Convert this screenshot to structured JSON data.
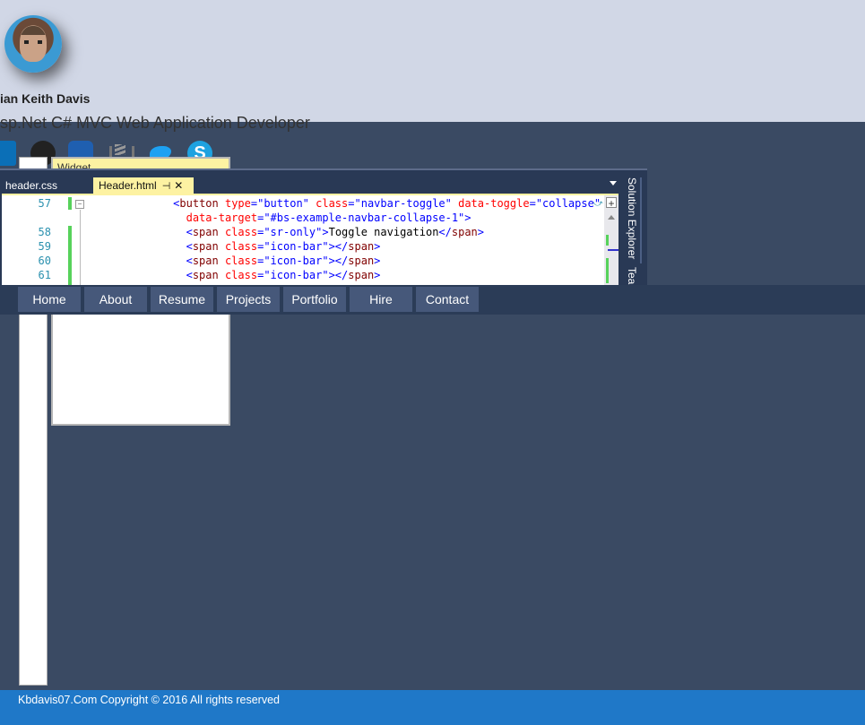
{
  "profile": {
    "name": "ian Keith Davis",
    "subtitle": "sp.Net C# MVC Web Application Developer"
  },
  "social_icons": [
    "linkedin-icon",
    "github-icon",
    "stackshare-icon",
    "stackoverflow-icon",
    "twitter-icon",
    "skype-icon"
  ],
  "background_panel": {
    "header_text": "Widget"
  },
  "editor": {
    "tabs": [
      {
        "label": "header.css",
        "active": false
      },
      {
        "label": "Header.html",
        "active": true,
        "pin_icon": "pin-icon",
        "close_label": "✕"
      }
    ],
    "line_numbers": [
      "57",
      "",
      "58",
      "59",
      "60",
      "61"
    ],
    "lines": [
      {
        "indent": "              ",
        "parts": [
          [
            "br",
            "<"
          ],
          [
            "tg",
            "button"
          ],
          [
            "",
            ""
          ],
          [
            "at",
            " type"
          ],
          [
            "br",
            "="
          ],
          [
            "st",
            "\"button\""
          ],
          [
            "at",
            " class"
          ],
          [
            "br",
            "="
          ],
          [
            "st",
            "\"navbar-toggle\""
          ],
          [
            "at",
            " data-toggle"
          ],
          [
            "br",
            "="
          ],
          [
            "st",
            "\"collapse\""
          ]
        ]
      },
      {
        "indent": "                ",
        "parts": [
          [
            "at",
            "data-target"
          ],
          [
            "br",
            "="
          ],
          [
            "st",
            "\"#bs-example-navbar-collapse-1\""
          ],
          [
            "br",
            ">"
          ]
        ]
      },
      {
        "indent": "                ",
        "parts": [
          [
            "br",
            "<"
          ],
          [
            "tg",
            "span"
          ],
          [
            "at",
            " class"
          ],
          [
            "br",
            "="
          ],
          [
            "st",
            "\"sr-only\""
          ],
          [
            "br",
            ">"
          ],
          [
            "",
            "Toggle navigation"
          ],
          [
            "br",
            "</"
          ],
          [
            "tg",
            "span"
          ],
          [
            "br",
            ">"
          ]
        ]
      },
      {
        "indent": "                ",
        "parts": [
          [
            "br",
            "<"
          ],
          [
            "tg",
            "span"
          ],
          [
            "at",
            " class"
          ],
          [
            "br",
            "="
          ],
          [
            "st",
            "\"icon-bar\""
          ],
          [
            "br",
            "></"
          ],
          [
            "tg",
            "span"
          ],
          [
            "br",
            ">"
          ]
        ]
      },
      {
        "indent": "                ",
        "parts": [
          [
            "br",
            "<"
          ],
          [
            "tg",
            "span"
          ],
          [
            "at",
            " class"
          ],
          [
            "br",
            "="
          ],
          [
            "st",
            "\"icon-bar\""
          ],
          [
            "br",
            "></"
          ],
          [
            "tg",
            "span"
          ],
          [
            "br",
            ">"
          ]
        ]
      },
      {
        "indent": "                ",
        "parts": [
          [
            "br",
            "<"
          ],
          [
            "tg",
            "span"
          ],
          [
            "at",
            " class"
          ],
          [
            "br",
            "="
          ],
          [
            "st",
            "\"icon-bar\""
          ],
          [
            "br",
            "></"
          ],
          [
            "tg",
            "span"
          ],
          [
            "br",
            ">"
          ]
        ]
      }
    ],
    "side_panel_labels": [
      "Solution Explorer",
      "Team"
    ]
  },
  "nav": {
    "items": [
      "Home",
      "About",
      "Resume",
      "Projects",
      "Portfolio",
      "Hire",
      "Contact"
    ]
  },
  "footer": {
    "text": "Kbdavis07.Com Copyright © 2016 All rights reserved"
  },
  "colors": {
    "top_band": "#d1d7e6",
    "page_background": "#3a4a63",
    "navbar": "#2b3c57",
    "nav_button": "#46587a",
    "footer": "#1f78c8",
    "vs_tab_active": "#fdf2a2",
    "vs_frame": "#293955"
  }
}
